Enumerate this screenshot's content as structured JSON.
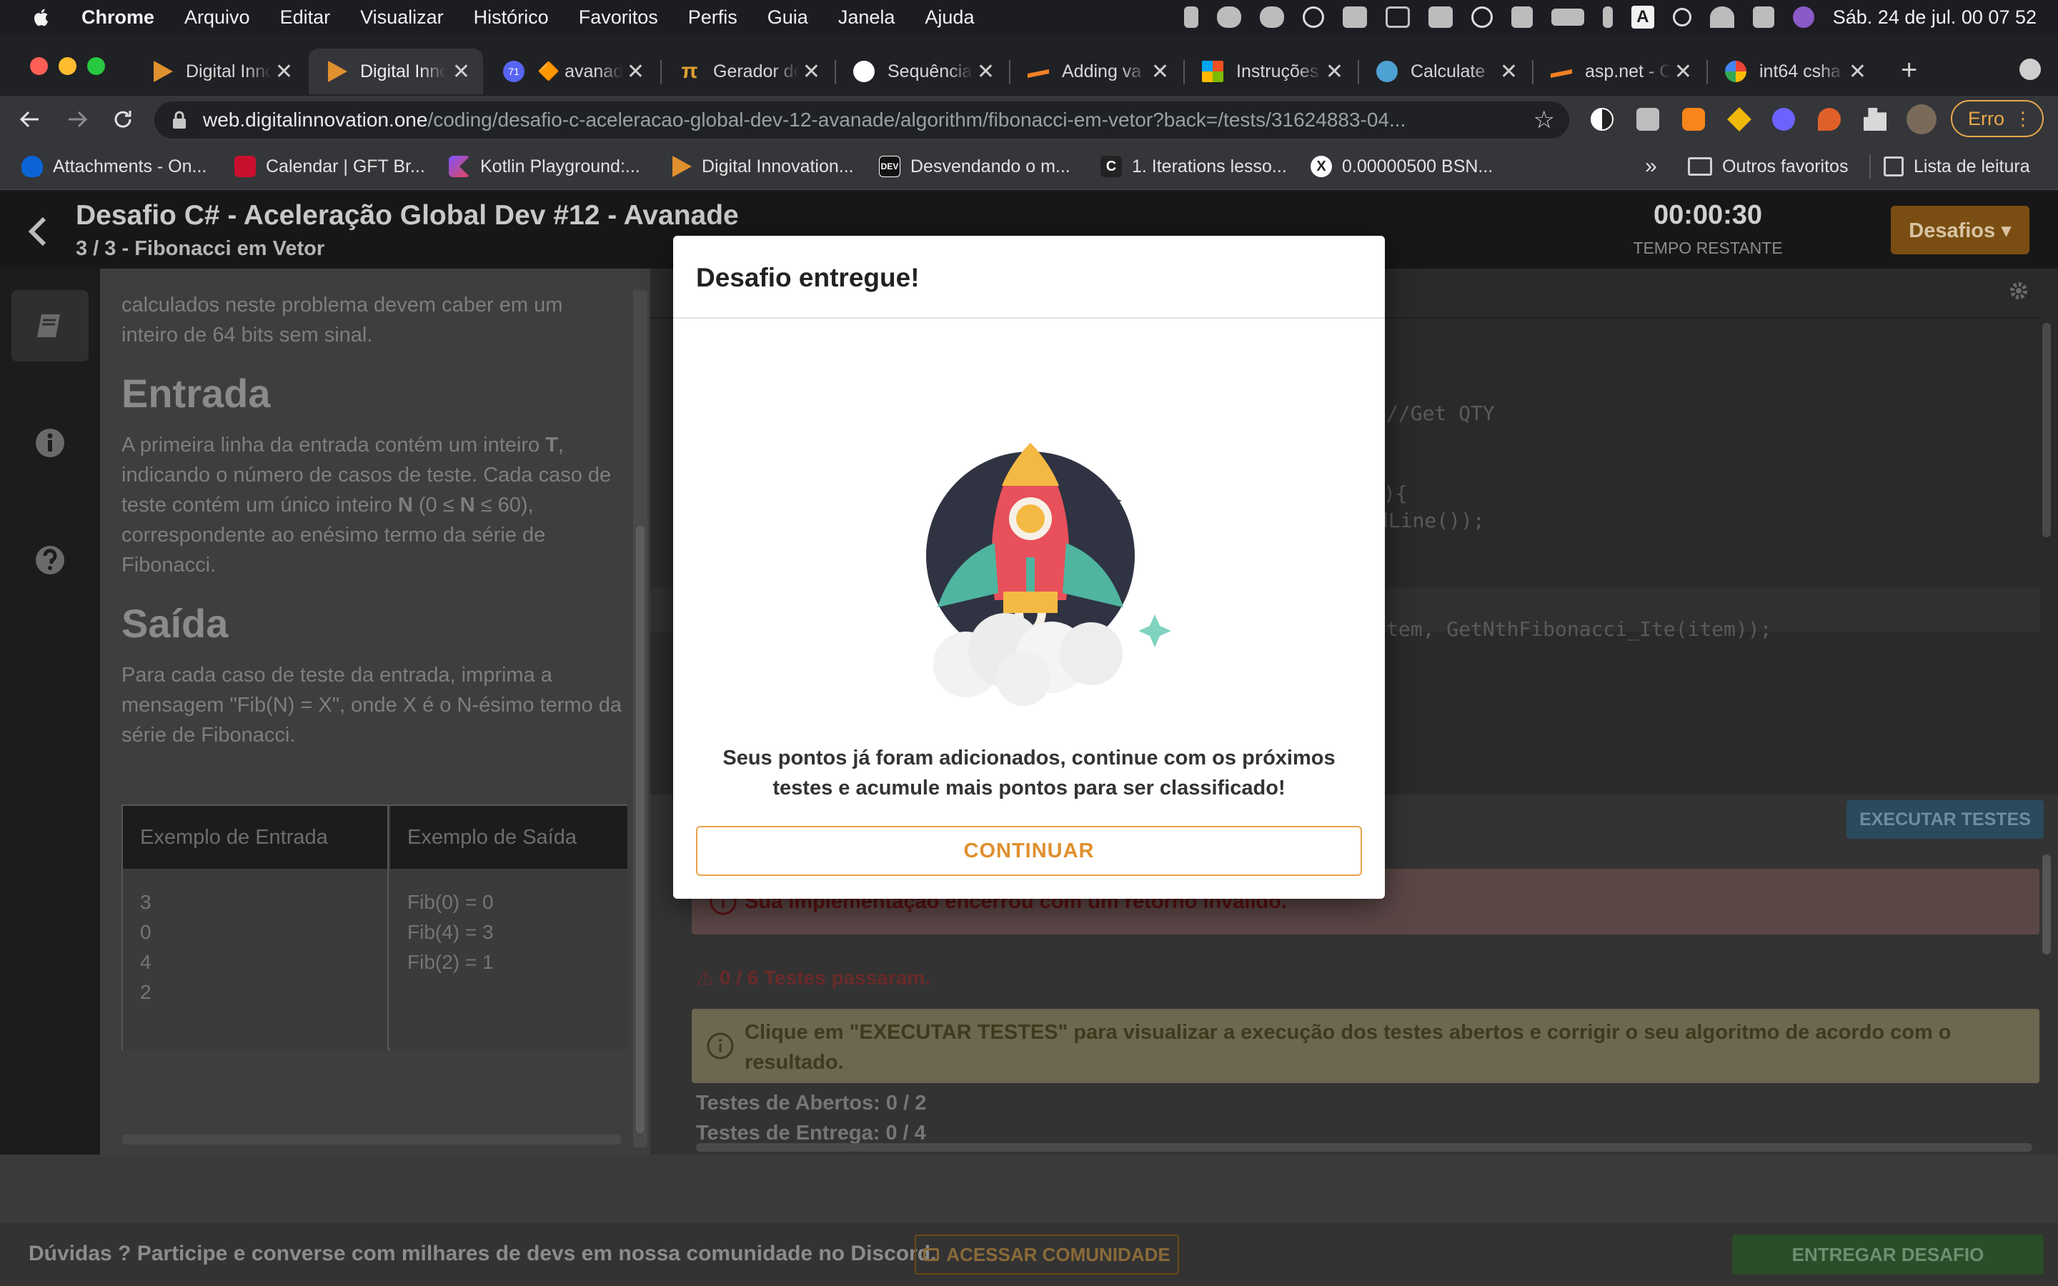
{
  "menubar": {
    "app": "Chrome",
    "items": [
      "Arquivo",
      "Editar",
      "Visualizar",
      "Histórico",
      "Favoritos",
      "Perfis",
      "Guia",
      "Janela",
      "Ajuda"
    ],
    "datetime": "Sáb. 24 de jul.  00 07 52",
    "keyboard_indicator": "A"
  },
  "tabs": [
    {
      "label": "Digital Innovation One",
      "favicon_color": "#e0902e",
      "active": false
    },
    {
      "label": "Digital Innovation One",
      "favicon_color": "#e0902e",
      "active": true
    },
    {
      "label": "🔶 avanade",
      "favicon_color": "#5865f2",
      "badge": "71",
      "active": false
    },
    {
      "label": "Gerador de",
      "favicon_color": "#e0a030",
      "active": false
    },
    {
      "label": "Sequência",
      "favicon_color": "#ffffff",
      "active": false
    },
    {
      "label": "Adding va",
      "favicon_color": "#f48024",
      "active": false
    },
    {
      "label": "Instruções",
      "favicon_color": "#7fba00",
      "active": false
    },
    {
      "label": "Calculate",
      "favicon_color": "#4ea1d3",
      "active": false
    },
    {
      "label": "asp.net - C",
      "favicon_color": "#f48024",
      "active": false
    },
    {
      "label": "int64 csha",
      "favicon_color": "#4285f4",
      "active": false
    }
  ],
  "toolbar": {
    "url_host": "web.digitalinnovation.one",
    "url_path": "/coding/desafio-c-aceleracao-global-dev-12-avanade/algorithm/fibonacci-em-vetor?back=/tests/31624883-04...",
    "profile_button": "Erro"
  },
  "bookmarks": [
    {
      "label": "Attachments - On...",
      "color": "#0a64d6"
    },
    {
      "label": "Calendar | GFT Br...",
      "color": "#c8102e"
    },
    {
      "label": "Kotlin Playground:...",
      "color": "#7f52ff"
    },
    {
      "label": "Digital Innovation...",
      "color": "#e0902e"
    },
    {
      "label": "Desvendando o m...",
      "color": "#111111"
    },
    {
      "label": "1. Iterations lesso...",
      "color": "#222222"
    },
    {
      "label": "0.00000500 BSN...",
      "color": "#ffffff"
    }
  ],
  "bookmarks_right": {
    "more": "»",
    "other": "Outros favoritos",
    "reading_list": "Lista de leitura"
  },
  "header": {
    "title": "Desafio C# - Aceleração Global Dev #12 - Avanade",
    "subtitle": "3 / 3 - Fibonacci em Vetor",
    "timer": "00:00:30",
    "timer_label": "TEMPO RESTANTE",
    "desafios_button": "Desafios ▾"
  },
  "problem": {
    "intro": "calculados neste problema devem caber em um inteiro de 64 bits sem sinal.",
    "input_heading": "Entrada",
    "input_text_html": "A primeira linha da entrada contém um inteiro <b>T</b>, indicando o número de casos de teste. Cada caso de teste contém um único inteiro <b>N</b> (0 ≤ <b>N</b> ≤ 60), correspondente ao enésimo termo da série de Fibonacci.",
    "output_heading": "Saída",
    "output_text": "Para cada caso de teste da entrada, imprima a mensagem \"Fib(N) = X\", onde X é o N-ésimo termo da série de Fibonacci.",
    "example_input_header": "Exemplo de Entrada",
    "example_output_header": "Exemplo de Saída",
    "example_input": "3\n0\n4\n2",
    "example_output": "Fib(0) = 0\nFib(4) = 3\nFib(2) = 1"
  },
  "editor": {
    "lines": [
      "//Get QTY",
      "){",
      "dLine());",
      "tem, GetNthFibonacci_Ite(item));"
    ]
  },
  "tests": {
    "run_button": "EXECUTAR TESTES",
    "error_message": "Sua implementação encerrou com um retorno inválido.",
    "passed": "0 / 6 Testes passaram.",
    "hint": "Clique em \"EXECUTAR TESTES\" para visualizar a execução dos testes abertos e corrigir o seu algoritmo de acordo com o resultado.",
    "open_tests": "Testes de Abertos: 0 / 2",
    "delivery_tests": "Testes de Entrega: 0 / 4"
  },
  "footer": {
    "text": "Dúvidas ?  Participe e converse com milhares de devs em nossa comunidade no Discord.",
    "community_button": "ACESSAR COMUNIDADE",
    "submit_button": "ENTREGAR DESAFIO"
  },
  "modal": {
    "title": "Desafio entregue!",
    "message": "Seus pontos já foram adicionados, continue com os próximos testes e acumule mais pontos para ser classificado!",
    "continue_button": "CONTINUAR"
  },
  "colors": {
    "accent_orange": "#e0902e",
    "modal_bg": "#ffffff",
    "success_green": "#2a4d2a",
    "error_red": "#5b4646"
  }
}
